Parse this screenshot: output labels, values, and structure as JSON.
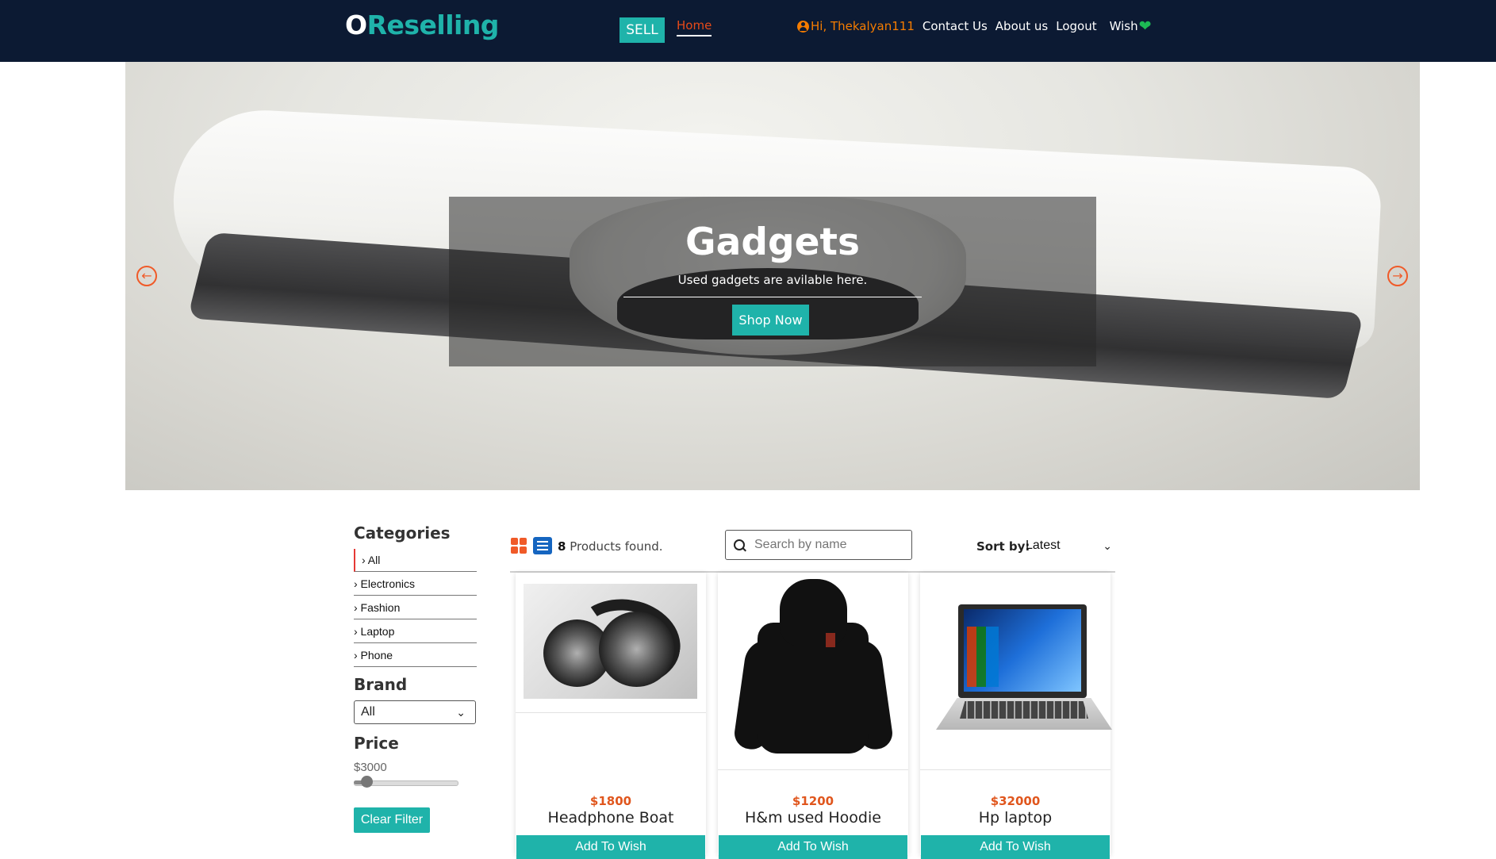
{
  "header": {
    "logo_first": "O",
    "logo_rest": "Reselling",
    "sell_label": "SELL",
    "home_label": "Home",
    "user_greeting": "Hi, Thekalyan111",
    "contact_label": "Contact Us",
    "about_label": "About us",
    "logout_label": "Logout",
    "wish_label": "Wish"
  },
  "hero": {
    "title": "Gadgets",
    "subtitle": "Used gadgets are avilable here.",
    "button_label": "Shop Now"
  },
  "filters": {
    "categories_title": "Categories",
    "categories": [
      "› All",
      "› Electronics",
      "› Fashion",
      "› Laptop",
      "› Phone"
    ],
    "selected_category_index": 0,
    "brand_title": "Brand",
    "brand_selected": "All",
    "price_title": "Price",
    "price_value": "$3000",
    "price_slider_fraction": 0.1,
    "clear_label": "Clear Filter"
  },
  "toolbar": {
    "count": "8",
    "count_suffix": " Products found.",
    "search_placeholder": "Search by name",
    "sort_label": "Sort by:",
    "sort_selected": "Latest"
  },
  "products": [
    {
      "price": "$1800",
      "name": "Headphone Boat",
      "button": "Add To Wish"
    },
    {
      "price": "$1200",
      "name": "H&m used Hoodie",
      "button": "Add To Wish"
    },
    {
      "price": "$32000",
      "name": "Hp laptop",
      "button": "Add To Wish"
    }
  ],
  "colors": {
    "header_bg": "#0c1a33",
    "accent_teal": "#1fb3aa",
    "accent_orange": "#f05a28",
    "price_color": "#e0561d",
    "wish_heart": "#1db954"
  },
  "icons": {
    "user": "user-circle-icon",
    "heart": "heart-icon",
    "prev": "arrow-left-circle-icon",
    "next": "arrow-right-circle-icon",
    "grid_view": "grid-view-icon",
    "list_view": "list-view-icon",
    "search": "search-icon",
    "chevron": "chevron-down-icon"
  }
}
